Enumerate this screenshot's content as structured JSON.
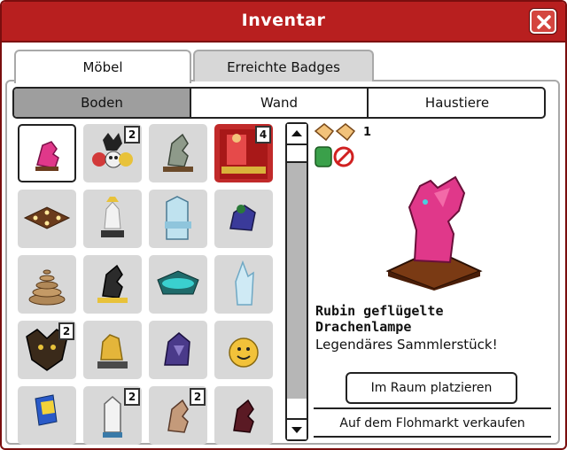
{
  "window": {
    "title": "Inventar"
  },
  "main_tabs": [
    {
      "label": "Möbel",
      "active": true
    },
    {
      "label": "Erreichte Badges",
      "active": false
    }
  ],
  "sub_tabs": [
    {
      "label": "Boden",
      "active": true
    },
    {
      "label": "Wand",
      "active": false
    },
    {
      "label": "Haustiere",
      "active": false
    }
  ],
  "grid": {
    "items": [
      {
        "name": "pink-dragon-bust",
        "count": ""
      },
      {
        "name": "skull-totem",
        "count": "2"
      },
      {
        "name": "grey-dragon-statue",
        "count": ""
      },
      {
        "name": "red-costume-display",
        "count": "4"
      },
      {
        "name": "brown-lit-tile",
        "count": ""
      },
      {
        "name": "white-angel-statue",
        "count": ""
      },
      {
        "name": "ice-throne",
        "count": ""
      },
      {
        "name": "blue-dragon-figure",
        "count": ""
      },
      {
        "name": "coiled-rope",
        "count": ""
      },
      {
        "name": "black-dragon-bust",
        "count": ""
      },
      {
        "name": "teal-bowl",
        "count": ""
      },
      {
        "name": "ice-crystal",
        "count": ""
      },
      {
        "name": "black-dragon-head",
        "count": "2"
      },
      {
        "name": "golden-lion-statue",
        "count": ""
      },
      {
        "name": "purple-dragon",
        "count": ""
      },
      {
        "name": "yellow-smiley-creature",
        "count": ""
      },
      {
        "name": "blue-yellow-flag-figure",
        "count": ""
      },
      {
        "name": "white-statue",
        "count": "2"
      },
      {
        "name": "brown-dragon-bust",
        "count": "2"
      },
      {
        "name": "dark-red-dragon-bust",
        "count": ""
      }
    ]
  },
  "detail": {
    "stack_count": "1",
    "name": "Rubin geflügelte Drachenlampe",
    "description": "Legendäres Sammlerstück!",
    "place_button": "Im Raum platzieren",
    "sell_button": "Auf dem Flohmarkt verkaufen"
  },
  "colors": {
    "titlebar": "#b81f1f",
    "accent_pink": "#e0388a",
    "slot_bg": "#d8d8d8"
  }
}
